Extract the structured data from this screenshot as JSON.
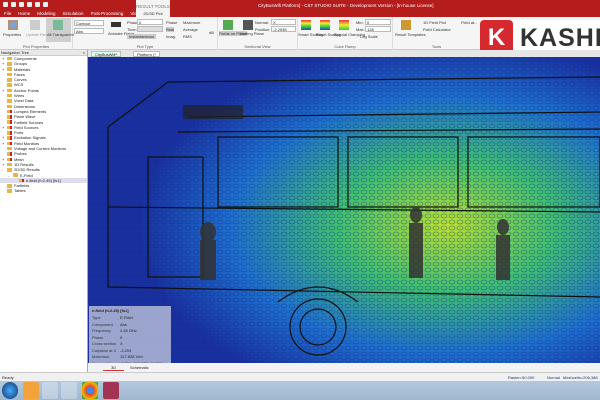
{
  "title": "CityBusWifi Platform] - CST STUDIO SUITE - Development Version - [In-house License]",
  "context_tab": {
    "group": "RESULT TOOLS",
    "tab": "2D/3D Plot"
  },
  "menu_tabs": [
    "File",
    "Home",
    "Modeling",
    "Simulation",
    "Post-Processing",
    "View"
  ],
  "ribbon": {
    "plot_properties": {
      "label": "Plot Properties",
      "properties": "Properties",
      "update_results": "Update Results",
      "all_transparent": "All Transparent",
      "contour": "Contour",
      "component": "Abs"
    },
    "plot_type": {
      "label": "Plot Type",
      "animate_fields": "Animate Fields",
      "phase_label": "Phase:",
      "phase_value": "0",
      "time_label": "Time:",
      "instantaneous": "Instantaneous",
      "phase": "Phase",
      "real": "Real",
      "imag": "Imag.",
      "maximum": "Maximum",
      "average": "Average",
      "rms": "RMS",
      "db": "dB"
    },
    "sectional_view": {
      "label": "Sectional View",
      "fields_on_plane": "Fields on Plane",
      "cutting_plane": "Cutting Plane",
      "normal_label": "Normal:",
      "normal_value": "X",
      "position_label": "Position:",
      "position_value": "-2.2035"
    },
    "color_ramp": {
      "label": "Color Ramp",
      "smart_scaling": "Smart Scaling",
      "reset_scaling": "Reset Scaling",
      "special_clamping": "Special Clamping",
      "min_label": "Min:",
      "min_value": "0",
      "max_label": "Max:",
      "max_value": "128",
      "log_scale": "Log Scale"
    },
    "tools": {
      "label": "Tools",
      "result_templates": "Result Templates",
      "field_plot_1d": "1D Field Plot",
      "field_calculator": "Field Calculator",
      "field_a": "Field at..."
    }
  },
  "logo_text": "KASHI",
  "nav": {
    "title": "Navigation Tree",
    "items": [
      {
        "label": "Components",
        "exp": "+",
        "red": false
      },
      {
        "label": "Groups",
        "exp": "+",
        "red": false
      },
      {
        "label": "Materials",
        "exp": "+",
        "red": false
      },
      {
        "label": "Faces",
        "exp": "",
        "red": false
      },
      {
        "label": "Curves",
        "exp": "",
        "red": false
      },
      {
        "label": "WCS",
        "exp": "",
        "red": false
      },
      {
        "label": "Anchor Points",
        "exp": "+",
        "red": false
      },
      {
        "label": "Wires",
        "exp": "",
        "red": false
      },
      {
        "label": "Voxel Data",
        "exp": "",
        "red": false
      },
      {
        "label": "Dimensions",
        "exp": "",
        "red": false
      },
      {
        "label": "Lumped Elements",
        "exp": "",
        "red": true
      },
      {
        "label": "Plane Wave",
        "exp": "",
        "red": true
      },
      {
        "label": "Farfield Sources",
        "exp": "",
        "red": true
      },
      {
        "label": "Field Sources",
        "exp": "+",
        "red": true
      },
      {
        "label": "Ports",
        "exp": "",
        "red": true
      },
      {
        "label": "Excitation Signals",
        "exp": "+",
        "red": true
      },
      {
        "label": "Field Monitors",
        "exp": "+",
        "red": true
      },
      {
        "label": "Voltage and Current Monitors",
        "exp": "",
        "red": false
      },
      {
        "label": "Probes",
        "exp": "",
        "red": true
      },
      {
        "label": "Mesh",
        "exp": "+",
        "red": true
      },
      {
        "label": "1D Results",
        "exp": "+",
        "red": false
      },
      {
        "label": "2D/3D Results",
        "exp": "-",
        "red": false
      },
      {
        "label": "E-Field",
        "exp": "-",
        "red": false,
        "indent": 1
      },
      {
        "label": "e-field (f=2.45) [fs1]",
        "exp": "",
        "red": true,
        "indent": 2,
        "selected": true
      },
      {
        "label": "Farfields",
        "exp": "",
        "red": false
      },
      {
        "label": "Tables",
        "exp": "",
        "red": false
      }
    ]
  },
  "doc_tabs": [
    "CityBusWifi*",
    "Platform (*"
  ],
  "info": {
    "title": "e-field (f=2.45) [fs1]",
    "rows": [
      [
        "Type",
        "E-Field"
      ],
      [
        "Component",
        "Abs"
      ],
      [
        "Frequency",
        "2.45 GHz"
      ],
      [
        "Phase",
        "0"
      ],
      [
        "Cross section",
        "X"
      ],
      [
        "Cutplane at X",
        "-2.204"
      ],
      [
        "Maximum",
        "127.828 V/m"
      ],
      [
        "Max position",
        "-2.204,  266.308,  19.710"
      ]
    ]
  },
  "view_tabs": [
    "3D",
    "Schematic"
  ],
  "status": {
    "left": "Ready",
    "raster": "Raster=50.000",
    "mode": "Normal",
    "meshcells": "Meshcells=206,388"
  },
  "taskbar_apps": [
    "windows-start",
    "outlook",
    "internet-explorer",
    "file-explorer",
    "chrome",
    "cst-studio"
  ],
  "colors": {
    "title_bar": "#b51c1c",
    "accent": "#d6282f"
  }
}
